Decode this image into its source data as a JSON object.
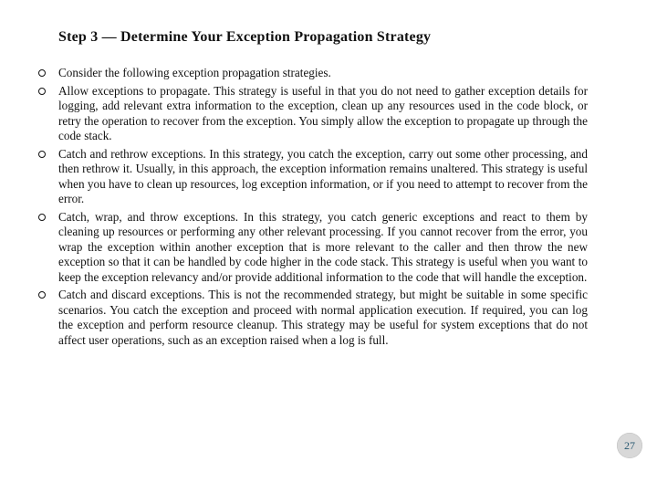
{
  "heading": "Step 3 — Determine Your Exception Propagation Strategy",
  "bullets": [
    "Consider the following exception propagation strategies.",
    "Allow exceptions to propagate. This strategy is useful in that you do not need to gather exception details for logging, add relevant extra information to the exception, clean up any resources used in the code block, or retry the operation to recover from the exception. You simply allow the exception to propagate up through the code stack.",
    "Catch and rethrow exceptions. In this strategy, you catch the exception, carry out some other processing, and then rethrow it. Usually, in this approach, the exception information remains unaltered. This strategy is useful when you have to clean up resources, log exception information, or if you need to attempt to recover from the error.",
    "Catch, wrap, and throw exceptions. In this strategy, you catch generic exceptions and react to them by cleaning up resources or performing any other relevant processing. If you cannot recover from the error, you wrap the exception within another exception that is more relevant to the caller and then throw the new exception so that it can be handled by code higher in the code stack. This strategy is useful when you want to keep the exception relevancy and/or provide additional information to the code that will handle the exception.",
    "Catch and discard exceptions. This is not the recommended strategy, but might be suitable in some specific scenarios. You catch the exception and proceed with normal application execution. If required, you can log the exception and perform resource cleanup. This strategy may be useful for system exceptions that do not affect user operations, such as an exception raised when a log is full."
  ],
  "page_number": "27"
}
